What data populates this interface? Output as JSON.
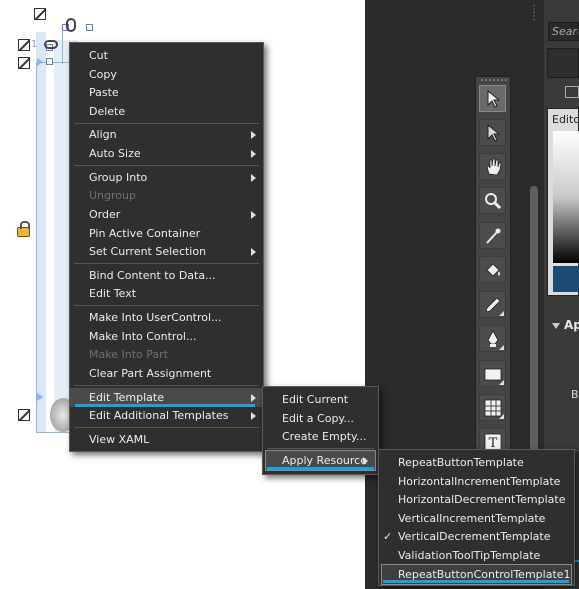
{
  "context_menu": {
    "items": [
      {
        "label": "Cut",
        "submenu": false,
        "disabled": false
      },
      {
        "label": "Copy",
        "submenu": false,
        "disabled": false
      },
      {
        "label": "Paste",
        "submenu": false,
        "disabled": false
      },
      {
        "label": "Delete",
        "submenu": false,
        "disabled": false
      },
      {
        "label": "Align",
        "submenu": true,
        "disabled": false
      },
      {
        "label": "Auto Size",
        "submenu": true,
        "disabled": false
      },
      {
        "label": "Group Into",
        "submenu": true,
        "disabled": false
      },
      {
        "label": "Ungroup",
        "submenu": false,
        "disabled": true
      },
      {
        "label": "Order",
        "submenu": true,
        "disabled": false
      },
      {
        "label": "Pin Active Container",
        "submenu": false,
        "disabled": false
      },
      {
        "label": "Set Current Selection",
        "submenu": true,
        "disabled": false
      },
      {
        "label": "Bind Content to Data...",
        "submenu": false,
        "disabled": false
      },
      {
        "label": "Edit Text",
        "submenu": false,
        "disabled": false
      },
      {
        "label": "Make Into UserControl...",
        "submenu": false,
        "disabled": false
      },
      {
        "label": "Make Into Control...",
        "submenu": false,
        "disabled": false
      },
      {
        "label": "Make Into Part",
        "submenu": false,
        "disabled": true
      },
      {
        "label": "Clear Part Assignment",
        "submenu": false,
        "disabled": false
      },
      {
        "label": "Edit Template",
        "submenu": true,
        "disabled": false,
        "highlighted": true
      },
      {
        "label": "Edit Additional Templates",
        "submenu": true,
        "disabled": false
      },
      {
        "label": "View XAML",
        "submenu": false,
        "disabled": false
      }
    ]
  },
  "template_menu": {
    "items": [
      {
        "label": "Edit Current",
        "submenu": false
      },
      {
        "label": "Edit a Copy...",
        "submenu": false
      },
      {
        "label": "Create Empty...",
        "submenu": false
      },
      {
        "label": "Apply Resource",
        "submenu": true,
        "highlighted": true
      }
    ]
  },
  "resource_menu": {
    "items": [
      {
        "label": "RepeatButtonTemplate",
        "checked": false
      },
      {
        "label": "HorizontalIncrementTemplate",
        "checked": false
      },
      {
        "label": "HorizontalDecrementTemplate",
        "checked": false
      },
      {
        "label": "VerticalIncrementTemplate",
        "checked": false
      },
      {
        "label": "VerticalDecrementTemplate",
        "checked": true
      },
      {
        "label": "ValidationToolTipTemplate",
        "checked": false
      },
      {
        "label": "RepeatButtonControlTemplate1",
        "checked": false
      }
    ],
    "check_glyph": "✓"
  },
  "right_panel": {
    "search_placeholder": "Search",
    "editor_label": "Editor",
    "appearance_label": "Ap",
    "b_label": "B"
  },
  "canvas": {
    "margin_number": "1"
  },
  "toolbar": {
    "tools": [
      "selection-tool-icon",
      "direct-selection-tool-icon",
      "pan-tool-icon",
      "zoom-tool-icon",
      "eyedropper-tool-icon",
      "paint-bucket-tool-icon",
      "pencil-tool-icon",
      "pen-tool-icon",
      "rectangle-tool-icon",
      "grid-tool-icon",
      "text-tool-icon"
    ]
  },
  "colors": {
    "menu_bg": "#2f2f2f",
    "menu_text": "#ececec",
    "disabled_text": "#6f6f6f",
    "accent_underline": "#1aa1e0",
    "app_dark": "#2b2b2b"
  }
}
